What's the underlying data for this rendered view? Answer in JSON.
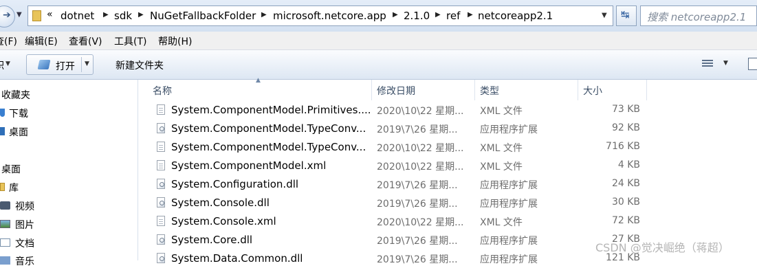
{
  "address_bar": {
    "overflow": "«",
    "crumbs": [
      "dotnet",
      "sdk",
      "NuGetFallbackFolder",
      "microsoft.netcore.app",
      "2.1.0",
      "ref",
      "netcoreapp2.1"
    ],
    "search_placeholder": "搜索 netcoreapp2.1"
  },
  "menu": [
    "查(F)",
    "编辑(E)",
    "查看(V)",
    "工具(T)",
    "帮助(H)"
  ],
  "toolbar": {
    "left_label": "积",
    "open_label": "打开",
    "new_folder_label": "新建文件夹"
  },
  "nav": {
    "favorites": "收藏夹",
    "downloads": "下载",
    "desktop": "桌面",
    "desktop_root": "桌面",
    "library": "库",
    "videos": "视频",
    "pictures": "图片",
    "documents": "文档",
    "music": "音乐"
  },
  "columns": {
    "name": "名称",
    "date": "修改日期",
    "type": "类型",
    "size": "大小"
  },
  "files": [
    {
      "name": "System.ComponentModel.Primitives....",
      "date": "2020\\10\\22 星期...",
      "type": "XML 文件",
      "size": "73 KB",
      "icon": "xml-file-icon"
    },
    {
      "name": "System.ComponentModel.TypeConv...",
      "date": "2019\\7\\26 星期...",
      "type": "应用程序扩展",
      "size": "92 KB",
      "icon": "dll-file-icon"
    },
    {
      "name": "System.ComponentModel.TypeConv...",
      "date": "2020\\10\\22 星期...",
      "type": "XML 文件",
      "size": "716 KB",
      "icon": "xml-file-icon"
    },
    {
      "name": "System.ComponentModel.xml",
      "date": "2020\\10\\22 星期...",
      "type": "XML 文件",
      "size": "4 KB",
      "icon": "xml-file-icon"
    },
    {
      "name": "System.Configuration.dll",
      "date": "2019\\7\\26 星期...",
      "type": "应用程序扩展",
      "size": "24 KB",
      "icon": "dll-file-icon"
    },
    {
      "name": "System.Console.dll",
      "date": "2019\\7\\26 星期...",
      "type": "应用程序扩展",
      "size": "30 KB",
      "icon": "dll-file-icon"
    },
    {
      "name": "System.Console.xml",
      "date": "2020\\10\\22 星期...",
      "type": "XML 文件",
      "size": "72 KB",
      "icon": "xml-file-icon"
    },
    {
      "name": "System.Core.dll",
      "date": "2019\\7\\26 星期...",
      "type": "应用程序扩展",
      "size": "27 KB",
      "icon": "dll-file-icon"
    },
    {
      "name": "System.Data.Common.dll",
      "date": "2019\\7\\26 星期...",
      "type": "应用程序扩展",
      "size": "121 KB",
      "icon": "dll-file-icon"
    }
  ],
  "watermark": "CSDN @觉决崛绝（蒋超）"
}
